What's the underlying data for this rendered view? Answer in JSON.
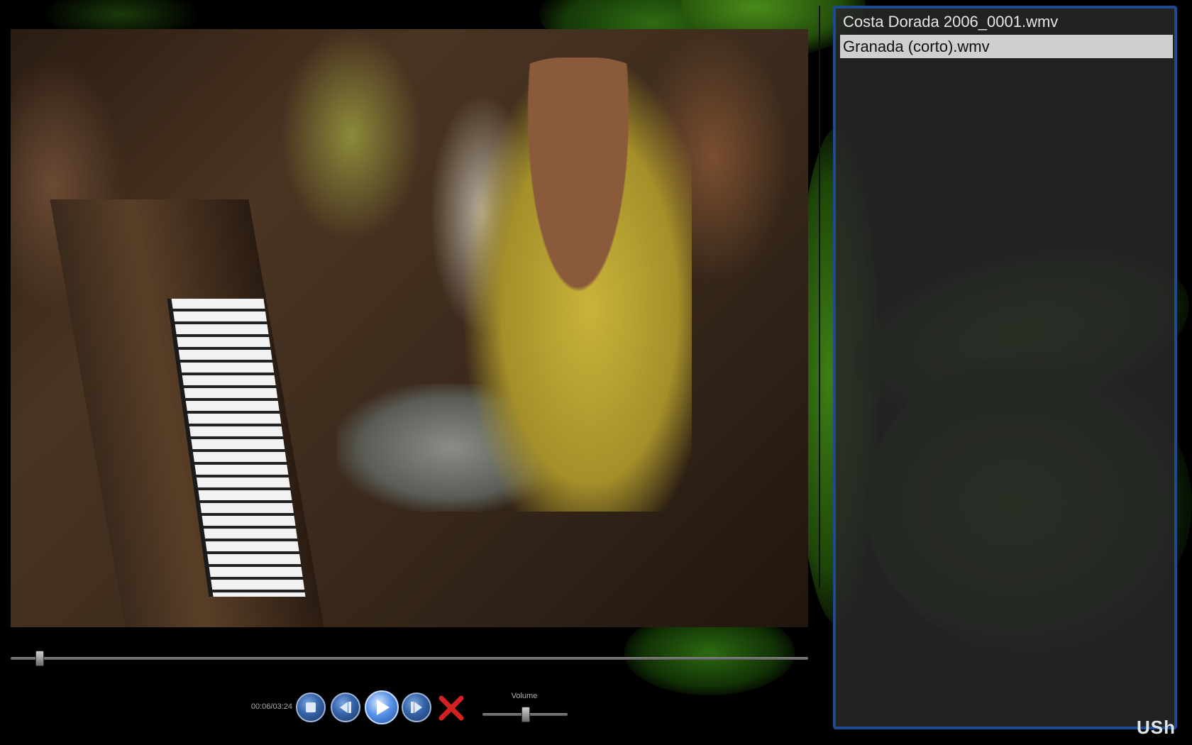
{
  "player": {
    "time_display": "00:06/03:24",
    "seek_fraction": 0.036,
    "volume_label": "Volume",
    "volume_fraction": 0.5
  },
  "controls": {
    "stop": "stop-icon",
    "previous": "previous-icon",
    "play": "play-icon",
    "next": "next-icon",
    "close": "close-icon"
  },
  "playlist": {
    "items": [
      {
        "label": "Costa Dorada 2006_0001.wmv",
        "selected": false
      },
      {
        "label": "Granada (corto).wmv",
        "selected": true
      }
    ]
  },
  "logo_text": "USh",
  "colors": {
    "accent_blue": "#1f4a8f",
    "selection": "#cfcfcf",
    "close_red": "#d32020"
  }
}
